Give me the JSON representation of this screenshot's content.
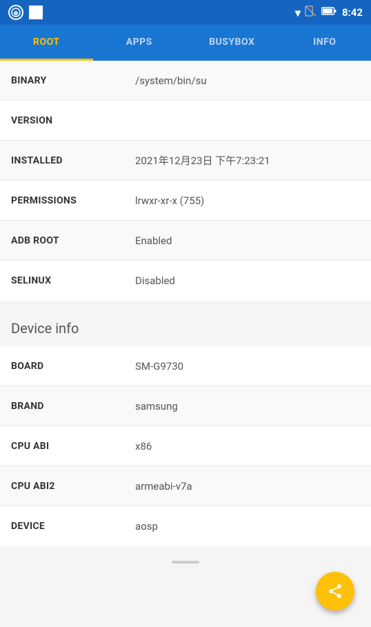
{
  "statusBar": {
    "time": "8:42",
    "leftIcons": [
      "app-icon",
      "square-icon"
    ],
    "rightIcons": [
      "wifi-icon",
      "sim-icon",
      "battery-icon"
    ]
  },
  "tabs": [
    {
      "label": "ROOT",
      "active": true
    },
    {
      "label": "APPS",
      "active": false
    },
    {
      "label": "BUSYBOX",
      "active": false
    },
    {
      "label": "INFO",
      "active": false
    }
  ],
  "rootInfo": {
    "rows": [
      {
        "label": "BINARY",
        "value": "/system/bin/su"
      },
      {
        "label": "VERSION",
        "value": ""
      },
      {
        "label": "INSTALLED",
        "value": "2021年12月23日 下午7:23:21"
      },
      {
        "label": "PERMISSIONS",
        "value": "lrwxr-xr-x (755)"
      },
      {
        "label": "ADB ROOT",
        "value": "Enabled"
      },
      {
        "label": "SELINUX",
        "value": "Disabled"
      }
    ]
  },
  "deviceInfo": {
    "sectionTitle": "Device info",
    "rows": [
      {
        "label": "BOARD",
        "value": "SM-G9730"
      },
      {
        "label": "BRAND",
        "value": "samsung"
      },
      {
        "label": "CPU ABI",
        "value": "x86"
      },
      {
        "label": "CPU ABI2",
        "value": "armeabi-v7a"
      },
      {
        "label": "DEVICE",
        "value": "aosp"
      }
    ]
  },
  "fab": {
    "label": "share"
  }
}
